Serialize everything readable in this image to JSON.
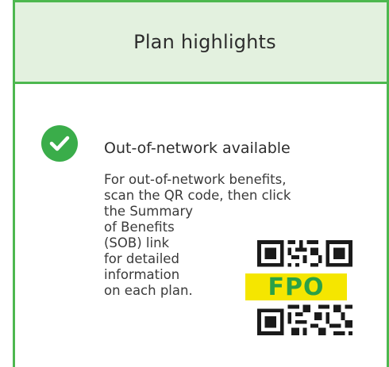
{
  "header": {
    "title": "Plan highlights"
  },
  "feature": {
    "icon": "checkmark-circle-icon",
    "title": "Out-of-network available",
    "description_lines": [
      "For out-of-network benefits,",
      "scan the QR code, then click",
      "the Summary",
      "of Benefits",
      "(SOB) link",
      "for detailed",
      "information",
      "on each plan."
    ]
  },
  "qr": {
    "icon": "qr-code-icon",
    "placeholder_label": "FPO"
  },
  "colors": {
    "accent_green": "#4db84f",
    "header_bg": "#e3f1df",
    "check_green": "#3aad4a",
    "fpo_yellow": "#f5e600",
    "fpo_text_green": "#2aa147"
  }
}
